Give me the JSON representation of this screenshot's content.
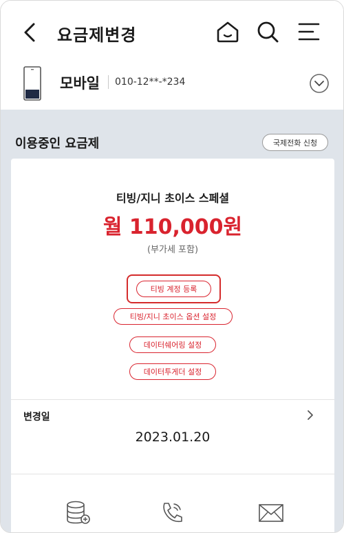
{
  "header": {
    "title": "요금제변경",
    "icons": [
      "back-arrow-icon",
      "home-icon",
      "search-icon",
      "menu-icon"
    ]
  },
  "line": {
    "name": "모바일",
    "number": "010-12**-*234"
  },
  "section": {
    "title": "이용중인 요금제",
    "intl_button": "국제전화 신청"
  },
  "plan": {
    "name": "티빙/지니 초이스 스페셜",
    "price": "월 110,000원",
    "vat_note": "(부가세 포함)",
    "actions": [
      "티빙 계정 등록",
      "티빙/지니 초이스 옵션 설정",
      "데이터쉐어링 설정",
      "데이터투게더 설정"
    ]
  },
  "change": {
    "label": "변경일",
    "date": "2023.01.20"
  },
  "bottom_icons": [
    "data-icon",
    "call-icon",
    "mail-icon"
  ],
  "colors": {
    "accent": "#d9232e",
    "background": "#dfe4ea"
  }
}
